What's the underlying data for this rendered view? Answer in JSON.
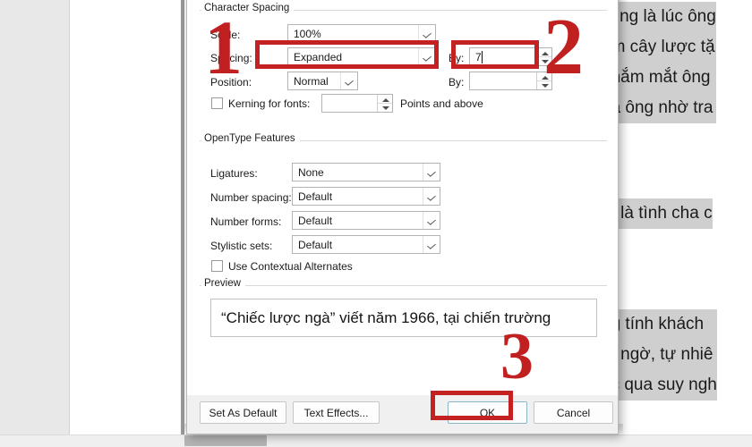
{
  "document": {
    "blocks": [
      {
        "lines": [
          "cũng là lúc ông",
          "àm cây lược tặ",
          "nhắm mắt ông",
          "ủa ông nhờ tra"
        ]
      },
      {
        "lines": [
          "ệt là tình cha c"
        ]
      },
      {
        "lines": [
          "ng tính khách ",
          "ất ngờ, tự nhiê",
          "ắc qua suy ngh"
        ]
      }
    ]
  },
  "dialog": {
    "character_spacing": {
      "group_title": "Character Spacing",
      "scale": {
        "label": "Scale:",
        "value": "100%"
      },
      "spacing": {
        "label": "Spacing:",
        "value": "Expanded",
        "by_label": "By:",
        "by_value": "7"
      },
      "position": {
        "label": "Position:",
        "value": "Normal",
        "by_label": "By:",
        "by_value": ""
      },
      "kerning": {
        "label": "Kerning for fonts:",
        "value": "",
        "suffix": "Points and above",
        "checked": false
      }
    },
    "opentype": {
      "group_title": "OpenType Features",
      "ligatures": {
        "label": "Ligatures:",
        "value": "None"
      },
      "number_spacing": {
        "label": "Number spacing:",
        "value": "Default"
      },
      "number_forms": {
        "label": "Number forms:",
        "value": "Default"
      },
      "stylistic_sets": {
        "label": "Stylistic sets:",
        "value": "Default"
      },
      "contextual_alternates": {
        "label": "Use Contextual Alternates",
        "checked": false
      }
    },
    "preview": {
      "group_title": "Preview",
      "text": "“Chiếc lược ngà” viết năm 1966, tại chiến trường"
    },
    "buttons": {
      "set_as_default": "Set As Default",
      "text_effects": "Text Effects...",
      "ok": "OK",
      "cancel": "Cancel"
    }
  },
  "annotations": {
    "accent_color": "#c42222",
    "steps": [
      {
        "number": "1"
      },
      {
        "number": "2"
      },
      {
        "number": "3"
      }
    ]
  }
}
